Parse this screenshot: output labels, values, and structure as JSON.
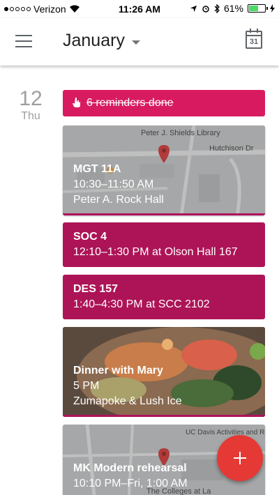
{
  "status_bar": {
    "carrier": "Verizon",
    "time": "11:26 AM",
    "battery": "61%",
    "battery_level": 0.61,
    "signal_bars": 1
  },
  "app_bar": {
    "month": "January",
    "calendar_day": "31"
  },
  "day": {
    "number": "12",
    "weekday": "Thu"
  },
  "reminder": {
    "text": "6 reminders done"
  },
  "map_labels": {
    "library": "Peter J. Shields Library",
    "street1": "Hutchison Dr",
    "street2": "UC Davis Activities and Recreat...ter",
    "campus": "The Colleges at La"
  },
  "events": [
    {
      "title": "MGT 11A",
      "time": "10:30–11:50 AM",
      "location": "Peter A. Rock Hall"
    },
    {
      "title": "SOC 4",
      "time": "12:10–1:30 PM at Olson Hall 167"
    },
    {
      "title": "DES 157",
      "time": "1:40–4:30 PM at SCC 2102"
    },
    {
      "title": "Dinner with Mary",
      "time": "5 PM",
      "location": "Zumapoke & Lush Ice"
    },
    {
      "title": "MK Modern rehearsal",
      "time": "10:10 PM–Fri, 1:00 AM"
    }
  ],
  "colors": {
    "accent_reminder": "#d81b60",
    "event_solid": "#ad1457",
    "fab": "#e53935"
  }
}
